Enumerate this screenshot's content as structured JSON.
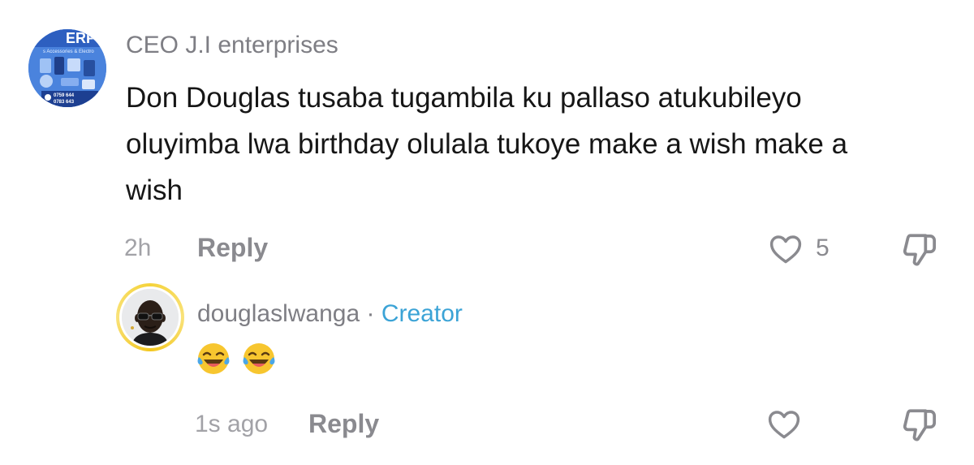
{
  "comment": {
    "username": "CEO J.I enterprises",
    "avatar_logo_text": "ERP",
    "avatar_caption": "s Accessories & Electro",
    "avatar_phone1": "0759 644",
    "avatar_phone2": "0783 643",
    "text": "Don Douglas tusaba tugambila ku pallaso atukubileyo oluyimba lwa birthday olulala tukoye make a wish make a wish",
    "time": "2h",
    "reply_label": "Reply",
    "like_count": "5",
    "like_icon": "heart-outline-icon",
    "dislike_icon": "thumbs-down-icon"
  },
  "reply": {
    "username": "douglaslwanga",
    "separator": " · ",
    "badge": "Creator",
    "emojis": [
      "😂",
      "😂"
    ],
    "time": "1s ago",
    "reply_label": "Reply",
    "like_icon": "heart-outline-icon",
    "dislike_icon": "thumbs-down-icon"
  },
  "colors": {
    "username": "#7e7e84",
    "body_text": "#161616",
    "meta_text": "#a2a2a7",
    "creator_badge": "#3ba3d6",
    "avatar_ring": "#f5d33a"
  }
}
